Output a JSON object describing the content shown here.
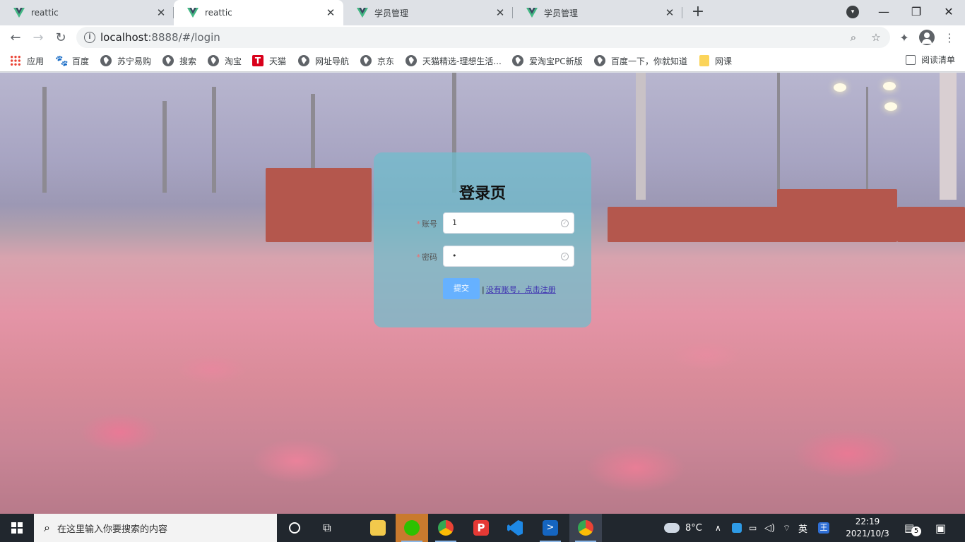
{
  "browser": {
    "tabs": [
      {
        "title": "reattic",
        "active": false
      },
      {
        "title": "reattic",
        "active": true
      },
      {
        "title": "学员管理",
        "active": false
      },
      {
        "title": "学员管理",
        "active": false
      }
    ],
    "url_host": "localhost",
    "url_rest": ":8888/#/login",
    "bookmarks": [
      {
        "label": "应用",
        "icon": "apps-icon"
      },
      {
        "label": "百度",
        "icon": "baidu-paw-icon"
      },
      {
        "label": "苏宁易购",
        "icon": "globe-icon"
      },
      {
        "label": "搜索",
        "icon": "globe-icon"
      },
      {
        "label": "淘宝",
        "icon": "globe-icon"
      },
      {
        "label": "天猫",
        "icon": "tmall-icon"
      },
      {
        "label": "网址导航",
        "icon": "globe-icon"
      },
      {
        "label": "京东",
        "icon": "globe-icon"
      },
      {
        "label": "天猫精选-理想生活...",
        "icon": "globe-icon"
      },
      {
        "label": "爱淘宝PC新版",
        "icon": "globe-icon"
      },
      {
        "label": "百度一下，你就知道",
        "icon": "globe-icon"
      },
      {
        "label": "网课",
        "icon": "folder-icon"
      }
    ],
    "reading_list": "阅读清单",
    "accent": "#1a73e8"
  },
  "login": {
    "title": "登录页",
    "account_label": "账号",
    "account_value": "1",
    "password_label": "密码",
    "password_value": "•",
    "submit_label": "提交",
    "register_sep": "|",
    "register_link": "没有账号，点击注册",
    "button_color": "#66b1ff",
    "required_color": "#f56c6c"
  },
  "taskbar": {
    "search_placeholder": "在这里输入你要搜索的内容",
    "weather": "8°C",
    "ime": "英",
    "time": "22:19",
    "date": "2021/10/3",
    "notification_count": "5"
  }
}
